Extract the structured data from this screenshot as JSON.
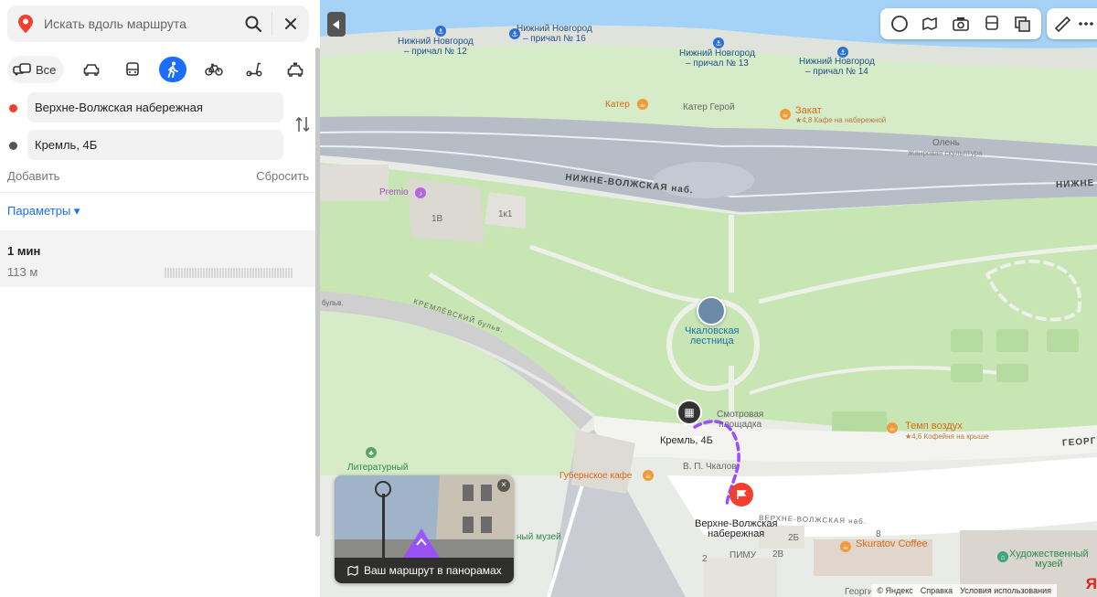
{
  "search": {
    "placeholder": "Искать вдоль маршрута"
  },
  "modes": {
    "all_label": "Все",
    "items": [
      "car-icon",
      "bus-icon",
      "walk-icon",
      "bike-icon",
      "scooter-icon",
      "taxi-icon"
    ],
    "active": "walk-icon"
  },
  "route_form": {
    "from": "Верхне-Волжская набережная",
    "to": "Кремль, 4Б",
    "add_label": "Добавить",
    "reset_label": "Сбросить",
    "params_label": "Параметры ▾"
  },
  "route_result": {
    "time": "1 мин",
    "distance": "113 м"
  },
  "colors": {
    "accent": "#1a6dff",
    "water": "#a5d3f7",
    "park": "#c8e5b4",
    "route": "#9b4dff",
    "from_marker": "#f43e2e"
  },
  "map": {
    "piers": [
      {
        "name": "Нижний Новгород\n– причал № 12"
      },
      {
        "name": "Нижний Новгород\n– причал № 16"
      },
      {
        "name": "Нижний Новгород\n– причал № 13"
      },
      {
        "name": "Нижний Новгород\n– причал № 14"
      }
    ],
    "pois": {
      "kater": "Катер",
      "kater_geroy": "Катер Герой",
      "zakat": "Закат",
      "zakat_sub": "★4,8 Кафе на набережной",
      "olen": "Олень",
      "olen_sub": "Жанровая скульптура",
      "premio": "Premio",
      "b1v": "1В",
      "b1k1": "1к1",
      "chkalov_stairs": "Чкаловская\nлестница",
      "smotr": "Смотровая\nплощадка",
      "kremlin": "Кремль, 4Б",
      "chkalov": "В. П. Чкалов",
      "gubern": "Губернское кафе",
      "temp": "Темп воздух",
      "temp_sub": "★4,6 Кофейня на крыше",
      "literary": "Литературный",
      "museum_part": "ный музей",
      "verkhne": "Верхне-Волжская\nнабережная",
      "pimu": "ПИМУ",
      "skuratov": "Skuratov Coffee",
      "art_museum": "Художественный\nмузей",
      "b2b": "2Б",
      "b2v": "2В",
      "b2": "2",
      "b8": "8"
    },
    "roads": {
      "nizhne": "НИЖНЕ-ВОЛЖСКАЯ наб.",
      "nizhne_right": "НИЖНЕ",
      "kreml_blvd": "КРЕМЛЁВСКИЙ бульв.",
      "blvd": "бульв.",
      "verkhne_road": "ВЕРХНЕ-ВОЛЖСКАЯ наб.",
      "georg": "ГЕОРГИ",
      "georg2": "Георги"
    },
    "panorama_caption": "Ваш маршрут в панорамах",
    "footer": [
      "© Яндекс",
      "Справка",
      "Условия использования"
    ],
    "brand": "Я"
  }
}
